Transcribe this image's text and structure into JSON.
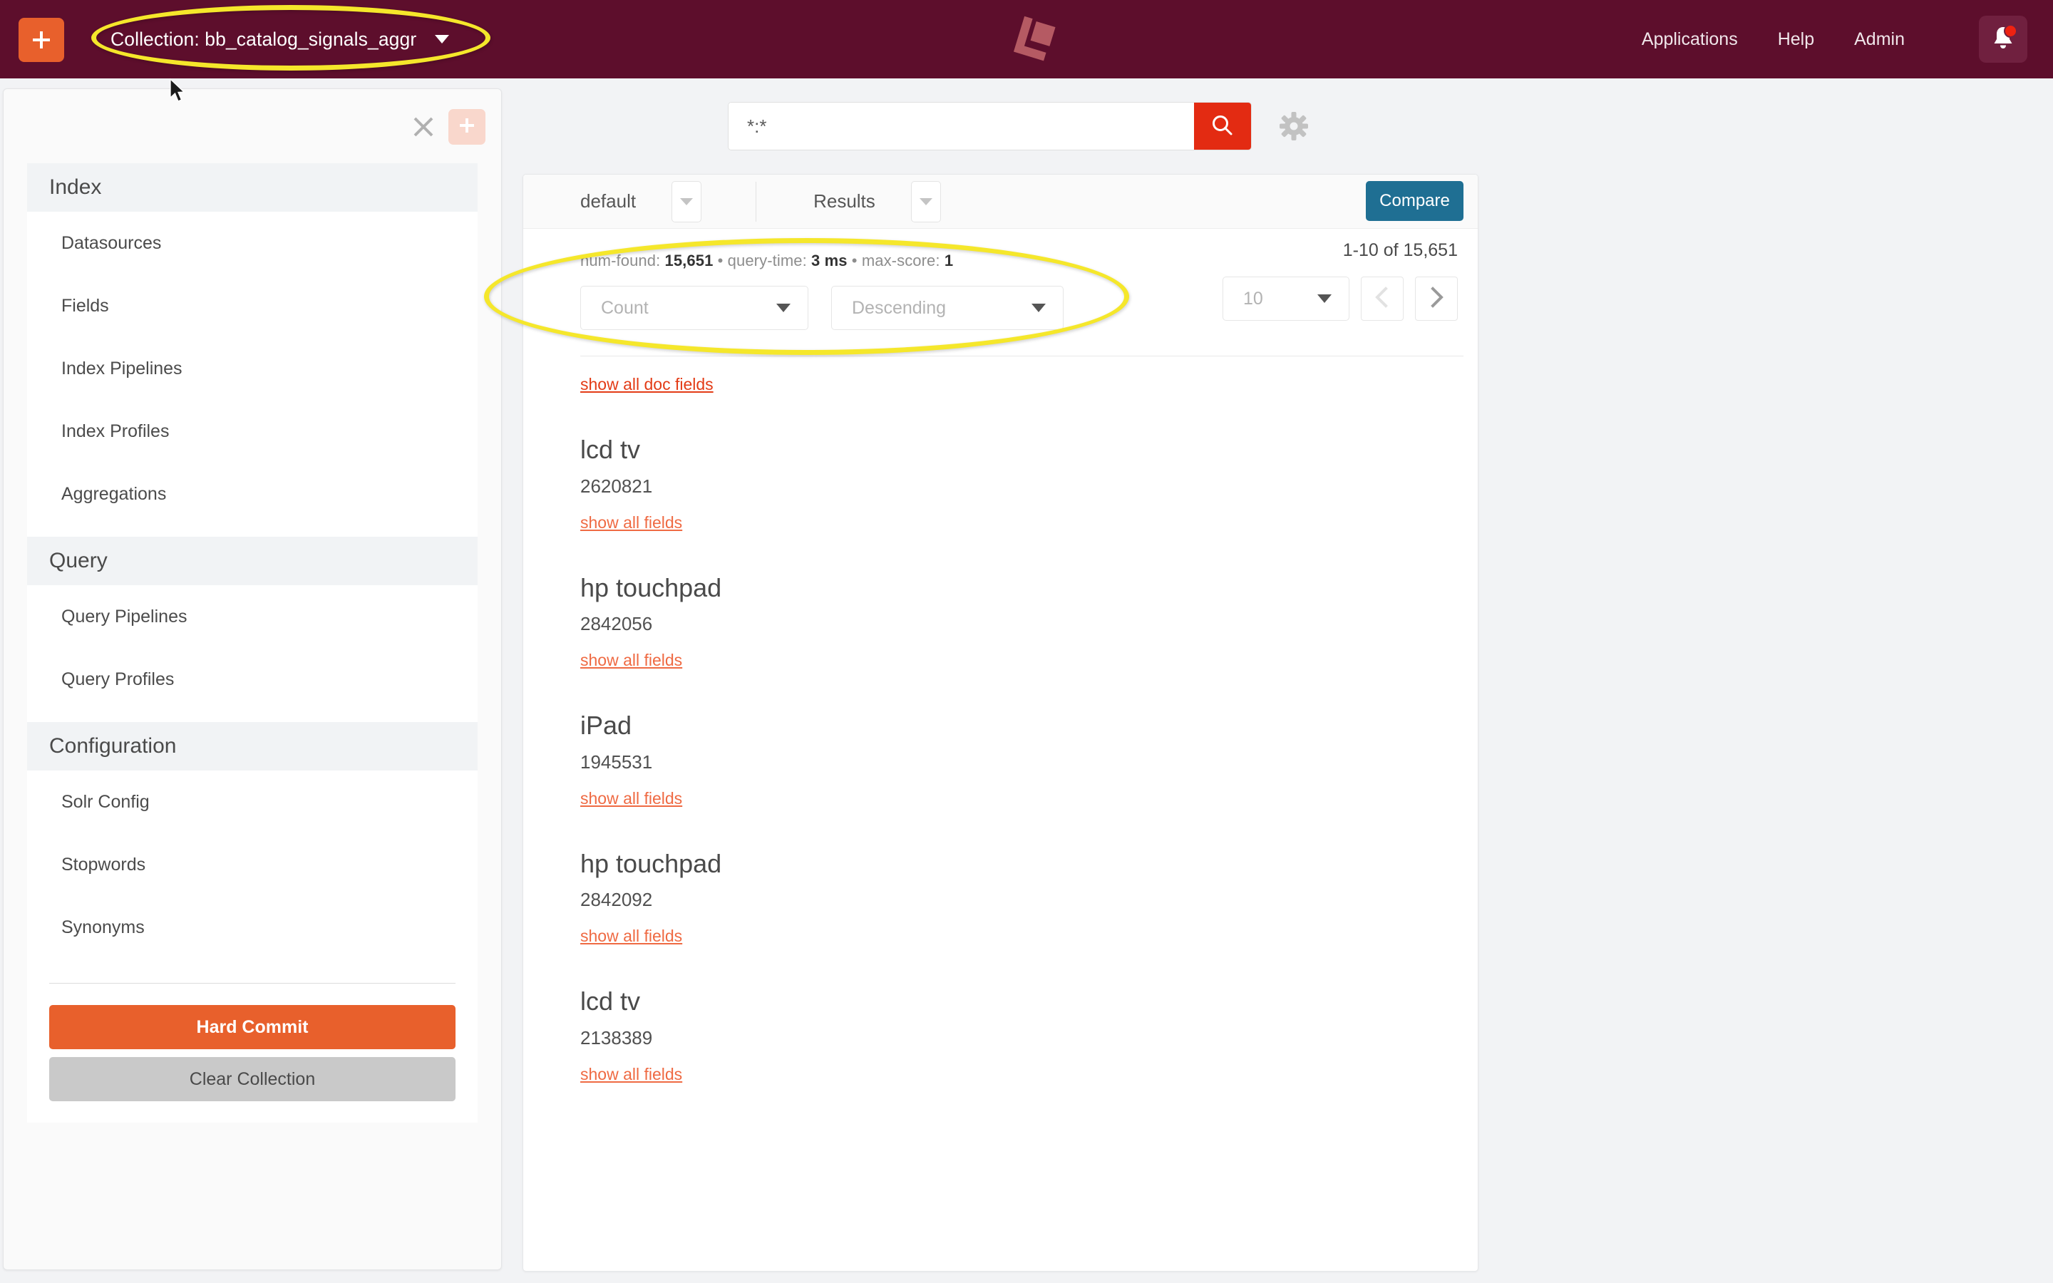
{
  "topbar": {
    "add_icon": "plus-icon",
    "collection_label": "Collection: bb_catalog_signals_aggr",
    "caret_icon": "chevron-down-icon",
    "logo_icon": "lucidworks-logo",
    "nav": [
      {
        "label": "Applications"
      },
      {
        "label": "Help"
      },
      {
        "label": "Admin"
      }
    ],
    "bell_icon": "bell-icon",
    "bell_has_notification": true,
    "bg_color": "#5d0e2c",
    "accent_color": "#e8602c"
  },
  "sidebar": {
    "close_icon": "close-icon",
    "add_icon": "plus-icon",
    "sections": [
      {
        "title": "Index",
        "items": [
          {
            "label": "Datasources"
          },
          {
            "label": "Fields"
          },
          {
            "label": "Index Pipelines"
          },
          {
            "label": "Index Profiles"
          },
          {
            "label": "Aggregations"
          }
        ]
      },
      {
        "title": "Query",
        "items": [
          {
            "label": "Query Pipelines"
          },
          {
            "label": "Query Profiles"
          }
        ]
      },
      {
        "title": "Configuration",
        "items": [
          {
            "label": "Solr Config"
          },
          {
            "label": "Stopwords"
          },
          {
            "label": "Synonyms"
          }
        ]
      }
    ],
    "actions": {
      "hard_commit_label": "Hard Commit",
      "clear_collection_label": "Clear Collection",
      "hard_commit_color": "#e8602c",
      "clear_collection_color": "#c9c9c9"
    }
  },
  "search": {
    "value": "*:*",
    "placeholder": "",
    "search_icon": "search-icon",
    "settings_icon": "gear-icon",
    "button_color": "#e32b12"
  },
  "panel": {
    "toolbar": {
      "profile_label": "default",
      "profile_caret_icon": "chevron-down-icon",
      "view_label": "Results",
      "view_caret_icon": "chevron-down-icon",
      "compare_label": "Compare",
      "compare_color": "#1f6f93"
    },
    "stats": {
      "num_found_label": "num-found:",
      "num_found_value": "15,651",
      "query_time_label": "query-time:",
      "query_time_value": "3 ms",
      "max_score_label": "max-score:",
      "max_score_value": "1",
      "separator": "•"
    },
    "sort": {
      "field_value": "Count",
      "direction_value": "Descending",
      "caret_icon": "chevron-down-icon"
    },
    "pager": {
      "range_label": "1-10 of 15,651",
      "page_size": "10",
      "page_size_caret_icon": "chevron-down-icon",
      "prev_icon": "chevron-left-icon",
      "next_icon": "chevron-right-icon",
      "prev_disabled": true,
      "next_disabled": false
    },
    "show_all_doc_fields_label": "show all doc fields",
    "results": [
      {
        "title": "lcd tv",
        "id": "2620821",
        "link_label": "show all fields"
      },
      {
        "title": "hp touchpad",
        "id": "2842056",
        "link_label": "show all fields"
      },
      {
        "title": "iPad",
        "id": "1945531",
        "link_label": "show all fields"
      },
      {
        "title": "hp touchpad",
        "id": "2842092",
        "link_label": "show all fields"
      },
      {
        "title": "lcd tv",
        "id": "2138389",
        "link_label": "show all fields"
      }
    ]
  },
  "annotations": {
    "highlight_color": "#f5e72b",
    "items": [
      {
        "target": "collection-selector"
      },
      {
        "target": "result-stats-and-sort"
      }
    ]
  }
}
